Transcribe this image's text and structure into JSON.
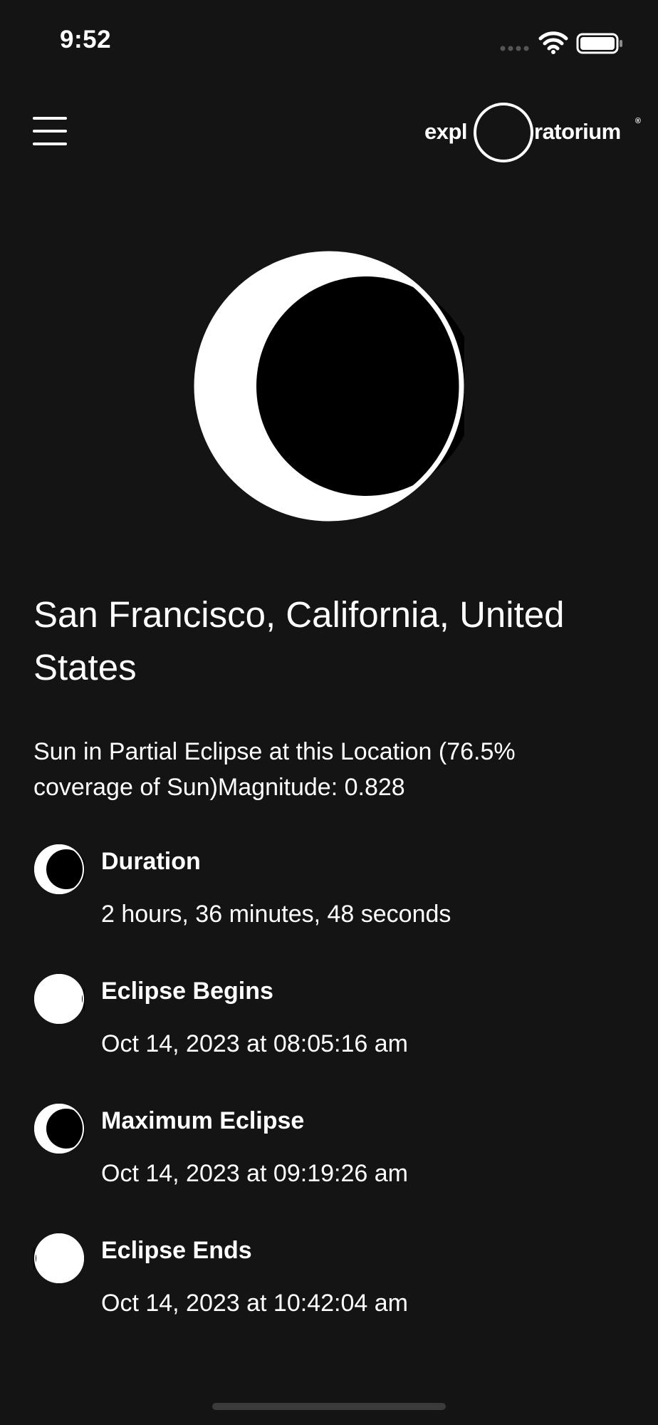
{
  "status_bar": {
    "time": "9:52",
    "icons": [
      "signal-icon",
      "wifi-icon",
      "battery-icon"
    ]
  },
  "header": {
    "menu_icon": "hamburger-menu-icon",
    "logo": {
      "left_text": "expl",
      "right_text": "ratorium",
      "registered_mark": "®"
    }
  },
  "hero": {
    "icon": "partial-eclipse-icon"
  },
  "location": {
    "title": "San Francisco, California, United States",
    "coverage_text": "Sun in Partial Eclipse at this Location (76.5% coverage of Sun)Magnitude: 0.828"
  },
  "events": [
    {
      "label": "Duration",
      "value": "2 hours, 36 minutes, 48 seconds",
      "icon": "partial-eclipse-icon"
    },
    {
      "label": "Eclipse Begins",
      "value": "Oct 14, 2023 at 08:05:16 am",
      "icon": "eclipse-begins-icon"
    },
    {
      "label": "Maximum Eclipse",
      "value": "Oct 14, 2023 at 09:19:26 am",
      "icon": "maximum-eclipse-icon"
    },
    {
      "label": "Eclipse Ends",
      "value": "Oct 14, 2023 at 10:42:04 am",
      "icon": "eclipse-ends-icon"
    }
  ],
  "colors": {
    "background": "#141414",
    "foreground": "#ffffff",
    "moon": "#000000"
  }
}
